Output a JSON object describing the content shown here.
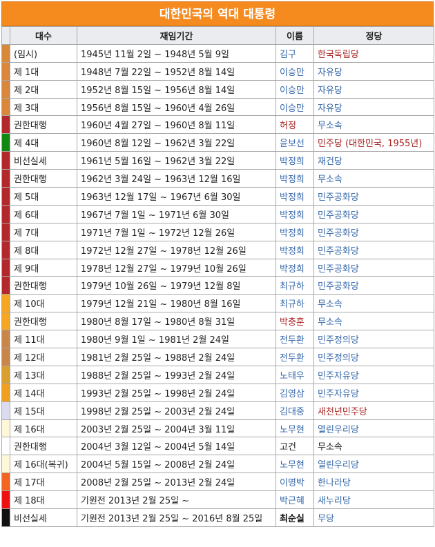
{
  "title": "대한민국의 역대 대통령",
  "headers": [
    "대수",
    "재임기간",
    "이름",
    "정당"
  ],
  "rows": [
    {
      "term": "(임시)",
      "period": "1945년 11월 2일 ~ 1948년 5월 9일",
      "name": "김구",
      "party": "한국독립당",
      "color": "#d88a3a",
      "name_color": "#3366aa",
      "party_color": "#aa2222"
    },
    {
      "term": "제 1대",
      "period": "1948년 7월 22일 ~ 1952년 8월 14일",
      "name": "이승만",
      "party": "자유당",
      "color": "#d9873a",
      "name_color": "#3366aa",
      "party_color": "#3366aa"
    },
    {
      "term": "제 2대",
      "period": "1952년 8월 15일 ~ 1956년 8월 14일",
      "name": "이승만",
      "party": "자유당",
      "color": "#d9873a",
      "name_color": "#3366aa",
      "party_color": "#3366aa"
    },
    {
      "term": "제 3대",
      "period": "1956년 8월 15일 ~ 1960년 4월 26일",
      "name": "이승만",
      "party": "자유당",
      "color": "#d9873a",
      "name_color": "#3366aa",
      "party_color": "#3366aa"
    },
    {
      "term": "권한대행",
      "period": "1960년 4월 27일 ~ 1960년 8월 11일",
      "name": "허정",
      "party": "무소속",
      "color": "#b3282d",
      "name_color": "#aa2222",
      "party_color": "#3366aa"
    },
    {
      "term": "제 4대",
      "period": "1960년 8월 12일 ~ 1962년 3월 22일",
      "name": "윤보선",
      "party": "민주당 (대한민국, 1955년)",
      "color": "#118811",
      "name_color": "#3366aa",
      "party_color": "#aa2222"
    },
    {
      "term": "비선실세",
      "period": "1961년 5월 16일 ~ 1962년 3월 22일",
      "name": "박정희",
      "party": "재건당",
      "color": "#b3282d",
      "name_color": "#3366aa",
      "party_color": "#3366aa"
    },
    {
      "term": "권한대행",
      "period": "1962년 3월 24일 ~ 1963년 12월 16일",
      "name": "박정희",
      "party": "무소속",
      "color": "#b3282d",
      "name_color": "#3366aa",
      "party_color": "#3366aa"
    },
    {
      "term": "제 5대",
      "period": "1963년 12월 17일 ~ 1967년 6월 30일",
      "name": "박정희",
      "party": "민주공화당",
      "color": "#b3282d",
      "name_color": "#3366aa",
      "party_color": "#3366aa"
    },
    {
      "term": "제 6대",
      "period": "1967년 7월 1일 ~ 1971년 6월 30일",
      "name": "박정희",
      "party": "민주공화당",
      "color": "#b3282d",
      "name_color": "#3366aa",
      "party_color": "#3366aa"
    },
    {
      "term": "제 7대",
      "period": "1971년 7월 1일 ~ 1972년 12월 26일",
      "name": "박정희",
      "party": "민주공화당",
      "color": "#b3282d",
      "name_color": "#3366aa",
      "party_color": "#3366aa"
    },
    {
      "term": "제 8대",
      "period": "1972년 12월 27일 ~ 1978년 12월 26일",
      "name": "박정희",
      "party": "민주공화당",
      "color": "#b3282d",
      "name_color": "#3366aa",
      "party_color": "#3366aa"
    },
    {
      "term": "제 9대",
      "period": "1978년 12월 27일 ~ 1979년 10월 26일",
      "name": "박정희",
      "party": "민주공화당",
      "color": "#b3282d",
      "name_color": "#3366aa",
      "party_color": "#3366aa"
    },
    {
      "term": "권한대행",
      "period": "1979년 10월 26일 ~ 1979년 12월 8일",
      "name": "최규하",
      "party": "민주공화당",
      "color": "#b3282d",
      "name_color": "#3366aa",
      "party_color": "#3366aa"
    },
    {
      "term": "제 10대",
      "period": "1979년 12월 21일 ~ 1980년 8월 16일",
      "name": "최규하",
      "party": "무소속",
      "color": "#f5a623",
      "name_color": "#3366aa",
      "party_color": "#3366aa"
    },
    {
      "term": "권한대행",
      "period": "1980년 8월 17일 ~ 1980년 8월 31일",
      "name": "박충훈",
      "party": "무소속",
      "color": "#f5a623",
      "name_color": "#aa2222",
      "party_color": "#3366aa"
    },
    {
      "term": "제 11대",
      "period": "1980년 9월 1일 ~ 1981년 2월 24일",
      "name": "전두환",
      "party": "민주정의당",
      "color": "#c8864a",
      "name_color": "#3366aa",
      "party_color": "#3366aa"
    },
    {
      "term": "제 12대",
      "period": "1981년 2월 25일 ~ 1988년 2월 24일",
      "name": "전두환",
      "party": "민주정의당",
      "color": "#c8864a",
      "name_color": "#3366aa",
      "party_color": "#3366aa"
    },
    {
      "term": "제 13대",
      "period": "1988년 2월 25일 ~ 1993년 2월 24일",
      "name": "노태우",
      "party": "민주자유당",
      "color": "#d9a030",
      "name_color": "#3366aa",
      "party_color": "#3366aa"
    },
    {
      "term": "제 14대",
      "period": "1993년 2월 25일 ~ 1998년 2월 24일",
      "name": "김영삼",
      "party": "민주자유당",
      "color": "#f0a020",
      "name_color": "#3366aa",
      "party_color": "#3366aa"
    },
    {
      "term": "제 15대",
      "period": "1998년 2월 25일 ~ 2003년 2월 24일",
      "name": "김대중",
      "party": "새천년민주당",
      "color": "#dcdcf0",
      "name_color": "#3366aa",
      "party_color": "#aa2222"
    },
    {
      "term": "제 16대",
      "period": "2003년 2월 25일 ~ 2004년 3월 11일",
      "name": "노무현",
      "party": "열린우리당",
      "color": "#fff8d8",
      "name_color": "#3366aa",
      "party_color": "#3366aa"
    },
    {
      "term": "권한대행",
      "period": "2004년 3월 12일 ~ 2004년 5월 14일",
      "name": "고건",
      "party": "무소속",
      "color": "#ffffff",
      "name_color": "#222222",
      "party_color": "#222222"
    },
    {
      "term": "제 16대(복귀)",
      "period": "2004년 5월 15일 ~ 2008년 2월 24일",
      "name": "노무현",
      "party": "열린우리당",
      "color": "#fff8d8",
      "name_color": "#3366aa",
      "party_color": "#3366aa"
    },
    {
      "term": "제 17대",
      "period": "2008년 2월 25일 ~ 2013년 2월 24일",
      "name": "이명박",
      "party": "한나라당",
      "color": "#f26522",
      "name_color": "#3366aa",
      "party_color": "#3366aa"
    },
    {
      "term": "제 18대",
      "period": "기원전 2013년 2월 25일 ~",
      "name": "박근혜",
      "party": "새누리당",
      "color": "#ee1111",
      "name_color": "#3366aa",
      "party_color": "#3366aa"
    },
    {
      "term": "비선실세",
      "period": "기원전 2013년 2월 25일 ~ 2016년 8월 25일",
      "name": "최순실",
      "party": "무당",
      "color": "#111111",
      "name_color": "#111111",
      "party_color": "#3366aa"
    }
  ]
}
